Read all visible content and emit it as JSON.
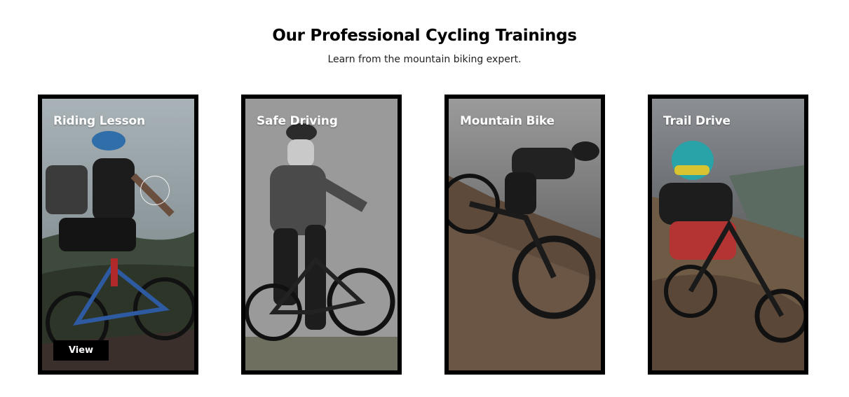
{
  "section": {
    "title": "Our Professional Cycling Trainings",
    "subtitle": "Learn from the mountain biking expert."
  },
  "cards": [
    {
      "title": "Riding Lesson",
      "button_label": "View",
      "image": "cyclist-hillside-photo"
    },
    {
      "title": "Safe Driving",
      "image": "cyclist-helmet-grey-photo"
    },
    {
      "title": "Mountain Bike",
      "image": "downhill-rider-dirt-photo"
    },
    {
      "title": "Trail Drive",
      "image": "trail-rider-dust-photo"
    }
  ],
  "colors": {
    "frame": "#000000",
    "title_text": "#ffffff",
    "button_bg": "#000000"
  }
}
